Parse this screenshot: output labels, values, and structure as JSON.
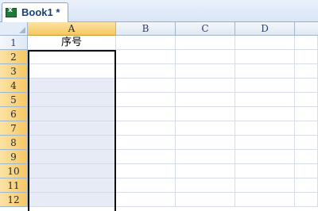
{
  "workbook_tab": {
    "label": "Book1 *",
    "icon": "excel-workbook-icon"
  },
  "columns": [
    "A",
    "B",
    "C",
    "D"
  ],
  "rows": [
    "1",
    "2",
    "3",
    "4",
    "5",
    "6",
    "7",
    "8",
    "9",
    "10",
    "11",
    "12"
  ],
  "cells": {
    "A1": "序号"
  },
  "colors": {
    "header_bg": "#e1e8f2",
    "selected_header": "#f7c762",
    "selection_fill": "#e6ebf6",
    "tab_text": "#15427a"
  }
}
